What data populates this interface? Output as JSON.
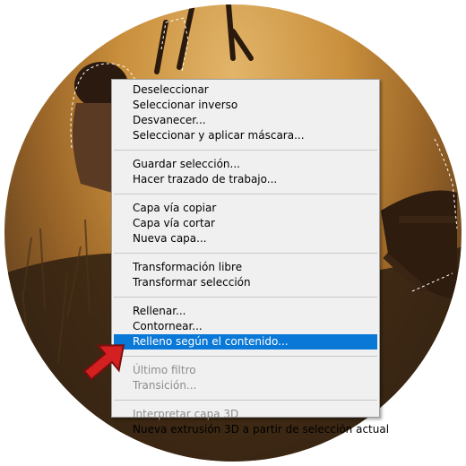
{
  "menu": {
    "groups": [
      {
        "items": [
          {
            "label": "Deseleccionar",
            "state": "enabled"
          },
          {
            "label": "Seleccionar inverso",
            "state": "enabled"
          },
          {
            "label": "Desvanecer...",
            "state": "enabled"
          },
          {
            "label": "Seleccionar y aplicar máscara...",
            "state": "enabled"
          }
        ]
      },
      {
        "items": [
          {
            "label": "Guardar selección...",
            "state": "enabled"
          },
          {
            "label": "Hacer trazado de trabajo...",
            "state": "enabled"
          }
        ]
      },
      {
        "items": [
          {
            "label": "Capa vía copiar",
            "state": "enabled"
          },
          {
            "label": "Capa vía cortar",
            "state": "enabled"
          },
          {
            "label": "Nueva capa...",
            "state": "enabled"
          }
        ]
      },
      {
        "items": [
          {
            "label": "Transformación libre",
            "state": "enabled"
          },
          {
            "label": "Transformar selección",
            "state": "enabled"
          }
        ]
      },
      {
        "items": [
          {
            "label": "Rellenar...",
            "state": "enabled"
          },
          {
            "label": "Contornear...",
            "state": "enabled"
          },
          {
            "label": "Relleno según el contenido...",
            "state": "highlighted"
          }
        ]
      },
      {
        "items": [
          {
            "label": "Último filtro",
            "state": "disabled"
          },
          {
            "label": "Transición...",
            "state": "disabled"
          }
        ]
      },
      {
        "items": [
          {
            "label": "Interpretar capa 3D",
            "state": "disabled"
          },
          {
            "label": "Nueva extrusión 3D a partir de selección actual",
            "state": "enabled"
          }
        ]
      }
    ]
  },
  "colors": {
    "highlight": "#0a78d7",
    "arrow": "#d42020"
  },
  "icons": {
    "pointer": "red-arrow-icon"
  }
}
